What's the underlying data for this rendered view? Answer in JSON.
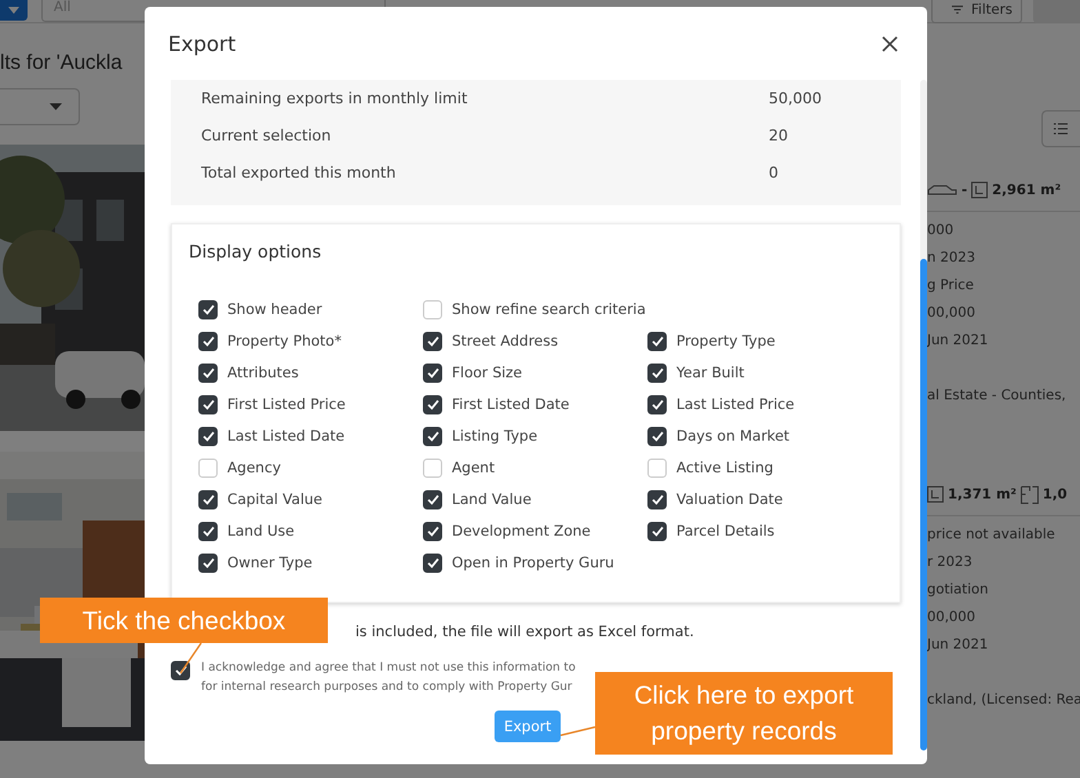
{
  "background_page": {
    "filter_bar": {
      "field": {
        "placeholder": "All"
      },
      "filters_button": "Filters"
    },
    "results_heading": "lts for 'Auckla",
    "listings": [
      {
        "stats": [
          {
            "kind": "car",
            "text": "-"
          },
          {
            "kind": "land",
            "text": "2,961 m²"
          }
        ],
        "lines": [
          "000",
          "n 2023",
          "g Price",
          "00,000",
          "Jun 2021",
          "al Estate - Counties,"
        ]
      },
      {
        "stats": [
          {
            "kind": "land",
            "text": "1,371 m²"
          },
          {
            "kind": "floor",
            "text": "1,0"
          }
        ],
        "lines": [
          "price not available",
          "r 2023",
          "gotiation",
          "00,000",
          "Jun 2021",
          "ckland, (Licensed: Rea"
        ]
      }
    ]
  },
  "dialog": {
    "title": "Export",
    "summary": [
      {
        "label": "Remaining exports in monthly limit",
        "value": "50,000"
      },
      {
        "label": "Current selection",
        "value": "20"
      },
      {
        "label": "Total exported this month",
        "value": "0"
      }
    ],
    "display_options": {
      "title": "Display options",
      "rows": [
        [
          {
            "label": "Show header",
            "checked": true
          },
          {
            "label": "Show refine search criteria",
            "checked": false
          }
        ],
        [
          {
            "label": "Property Photo*",
            "checked": true
          },
          {
            "label": "Street Address",
            "checked": true
          },
          {
            "label": "Property Type",
            "checked": true
          }
        ],
        [
          {
            "label": "Attributes",
            "checked": true
          },
          {
            "label": "Floor Size",
            "checked": true
          },
          {
            "label": "Year Built",
            "checked": true
          }
        ],
        [
          {
            "label": "First Listed Price",
            "checked": true
          },
          {
            "label": "First Listed Date",
            "checked": true
          },
          {
            "label": "Last Listed Price",
            "checked": true
          }
        ],
        [
          {
            "label": "Last Listed Date",
            "checked": true
          },
          {
            "label": "Listing Type",
            "checked": true
          },
          {
            "label": "Days on Market",
            "checked": true
          }
        ],
        [
          {
            "label": "Agency",
            "checked": false
          },
          {
            "label": "Agent",
            "checked": false
          },
          {
            "label": "Active Listing",
            "checked": false
          }
        ],
        [
          {
            "label": "Capital Value",
            "checked": true
          },
          {
            "label": "Land Value",
            "checked": true
          },
          {
            "label": "Valuation Date",
            "checked": true
          }
        ],
        [
          {
            "label": "Land Use",
            "checked": true
          },
          {
            "label": "Development Zone",
            "checked": true
          },
          {
            "label": "Parcel Details",
            "checked": true
          }
        ],
        [
          {
            "label": "Owner Type",
            "checked": true
          },
          {
            "label": "Open in Property Guru",
            "checked": true
          }
        ]
      ]
    },
    "format_note": "is included, the file will export as Excel format.",
    "acknowledgement": {
      "checked": true,
      "lines": [
        "I acknowledge and agree that I must not use this information to",
        "for internal research purposes and to comply with Property Gur"
      ]
    },
    "export_button": "Export"
  },
  "callouts": [
    {
      "text": "Tick the checkbox"
    },
    {
      "text": "Click here to export property records"
    }
  ]
}
